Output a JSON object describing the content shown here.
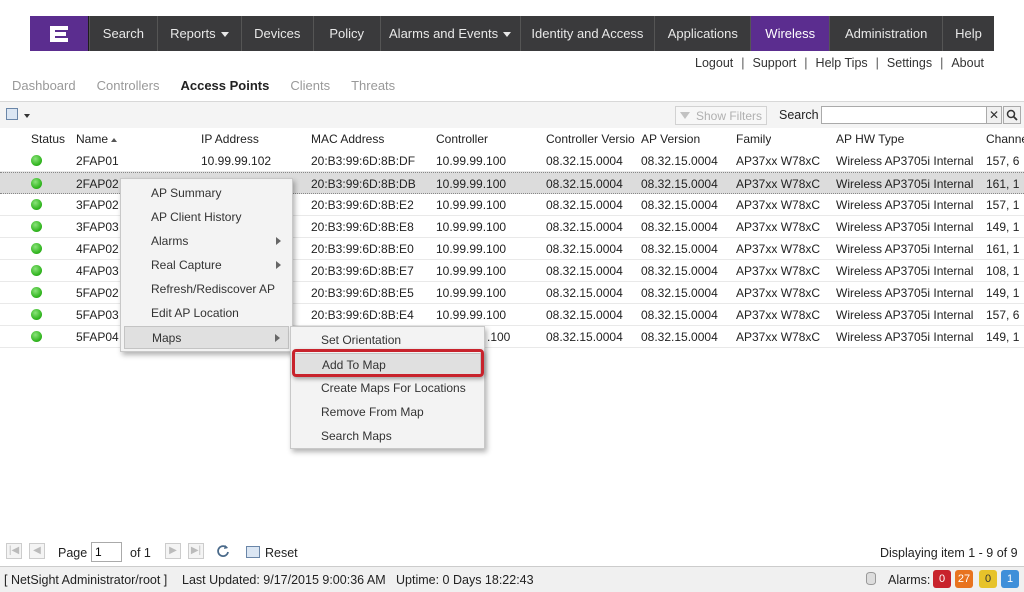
{
  "nav": {
    "logo_icon": "extreme-networks-logo",
    "items": [
      {
        "label": "Search",
        "dropdown": false,
        "active": false
      },
      {
        "label": "Reports",
        "dropdown": true,
        "active": false
      },
      {
        "label": "Devices",
        "dropdown": false,
        "active": false
      },
      {
        "label": "Policy",
        "dropdown": false,
        "active": false
      },
      {
        "label": "Alarms and Events",
        "dropdown": true,
        "active": false
      },
      {
        "label": "Identity and Access",
        "dropdown": false,
        "active": false
      },
      {
        "label": "Applications",
        "dropdown": false,
        "active": false
      },
      {
        "label": "Wireless",
        "dropdown": false,
        "active": true
      },
      {
        "label": "Administration",
        "dropdown": false,
        "active": false
      },
      {
        "label": "Help",
        "dropdown": false,
        "active": false
      }
    ],
    "active_color": "#5b2d8f",
    "bar_color": "#3a3a3c"
  },
  "top_links": [
    "Logout",
    "Support",
    "Help Tips",
    "Settings",
    "About"
  ],
  "subtabs": [
    {
      "label": "Dashboard",
      "active": false
    },
    {
      "label": "Controllers",
      "active": false
    },
    {
      "label": "Access Points",
      "active": true
    },
    {
      "label": "Clients",
      "active": false
    },
    {
      "label": "Threats",
      "active": false
    }
  ],
  "toolbar": {
    "show_filters": "Show Filters",
    "search_label": "Search",
    "search_value": "",
    "clear_icon": "close-icon",
    "search_icon": "magnifier-icon"
  },
  "table": {
    "columns": [
      "Status",
      "Name",
      "IP Address",
      "MAC Address",
      "Controller",
      "Controller Versio",
      "AP Version",
      "Family",
      "AP HW Type",
      "Channe"
    ],
    "sorted_column": "Name",
    "rows": [
      {
        "status": "up",
        "name": "2FAP01",
        "ip": "10.99.99.102",
        "mac": "20:B3:99:6D:8B:DF",
        "controller": "10.99.99.100",
        "ctrl_version": "08.32.15.0004",
        "ap_version": "08.32.15.0004",
        "family": "AP37xx W78xC",
        "hw": "Wireless AP3705i Internal",
        "channel": "157, 6"
      },
      {
        "status": "up",
        "name": "2FAP02",
        "ip": "",
        "mac": "20:B3:99:6D:8B:DB",
        "controller": "10.99.99.100",
        "ctrl_version": "08.32.15.0004",
        "ap_version": "08.32.15.0004",
        "family": "AP37xx W78xC",
        "hw": "Wireless AP3705i Internal",
        "channel": "161, 1"
      },
      {
        "status": "up",
        "name": "3FAP02",
        "ip": "",
        "mac": "20:B3:99:6D:8B:E2",
        "controller": "10.99.99.100",
        "ctrl_version": "08.32.15.0004",
        "ap_version": "08.32.15.0004",
        "family": "AP37xx W78xC",
        "hw": "Wireless AP3705i Internal",
        "channel": "157, 1"
      },
      {
        "status": "up",
        "name": "3FAP03",
        "ip": "",
        "mac": "20:B3:99:6D:8B:E8",
        "controller": "10.99.99.100",
        "ctrl_version": "08.32.15.0004",
        "ap_version": "08.32.15.0004",
        "family": "AP37xx W78xC",
        "hw": "Wireless AP3705i Internal",
        "channel": "149, 1"
      },
      {
        "status": "up",
        "name": "4FAP02",
        "ip": "",
        "mac": "20:B3:99:6D:8B:E0",
        "controller": "10.99.99.100",
        "ctrl_version": "08.32.15.0004",
        "ap_version": "08.32.15.0004",
        "family": "AP37xx W78xC",
        "hw": "Wireless AP3705i Internal",
        "channel": "161, 1"
      },
      {
        "status": "up",
        "name": "4FAP03",
        "ip": "",
        "mac": "20:B3:99:6D:8B:E7",
        "controller": "10.99.99.100",
        "ctrl_version": "08.32.15.0004",
        "ap_version": "08.32.15.0004",
        "family": "AP37xx W78xC",
        "hw": "Wireless AP3705i Internal",
        "channel": "108, 1"
      },
      {
        "status": "up",
        "name": "5FAP02",
        "ip": "",
        "mac": "20:B3:99:6D:8B:E5",
        "controller": "10.99.99.100",
        "ctrl_version": "08.32.15.0004",
        "ap_version": "08.32.15.0004",
        "family": "AP37xx W78xC",
        "hw": "Wireless AP3705i Internal",
        "channel": "149, 1"
      },
      {
        "status": "up",
        "name": "5FAP03",
        "ip": "",
        "mac": "20:B3:99:6D:8B:E4",
        "controller": "10.99.99.100",
        "ctrl_version": "08.32.15.0004",
        "ap_version": "08.32.15.0004",
        "family": "AP37xx W78xC",
        "hw": "Wireless AP3705i Internal",
        "channel": "157, 6"
      },
      {
        "status": "up",
        "name": "5FAP04",
        "ip": "",
        "mac": "",
        "controller": ".100",
        "ctrl_version": "08.32.15.0004",
        "ap_version": "08.32.15.0004",
        "family": "AP37xx W78xC",
        "hw": "Wireless AP3705i Internal",
        "channel": "149, 1"
      }
    ],
    "status_color": "#31b51f"
  },
  "context_menu": {
    "items": [
      {
        "label": "AP Summary",
        "submenu": false
      },
      {
        "label": "AP Client History",
        "submenu": false
      },
      {
        "label": "Alarms",
        "submenu": true
      },
      {
        "label": "Real Capture",
        "submenu": true
      },
      {
        "label": "Refresh/Rediscover AP",
        "submenu": false
      },
      {
        "label": "Edit AP Location",
        "submenu": false
      },
      {
        "label": "Maps",
        "submenu": true,
        "highlighted": true
      }
    ]
  },
  "maps_submenu": {
    "items": [
      {
        "label": "Set Orientation"
      },
      {
        "label": "Add To Map",
        "highlighted": true
      },
      {
        "label": "Create Maps For Locations"
      },
      {
        "label": "Remove From Map"
      },
      {
        "label": "Search Maps"
      }
    ],
    "annotation_color": "#c8232c"
  },
  "pager": {
    "page_label": "Page",
    "page_value": "1",
    "of_label": "of 1",
    "reset_label": "Reset",
    "displaying": "Displaying item 1 - 9 of 9"
  },
  "status_bar": {
    "user": "[ NetSight Administrator/root ]",
    "last_updated": "Last Updated: 9/17/2015 9:00:36 AM",
    "uptime": "Uptime: 0 Days 18:22:43",
    "alarms_label": "Alarms:",
    "alarm_counts": [
      {
        "value": "0",
        "color": "#c8232c"
      },
      {
        "value": "27",
        "color": "#e8731f"
      },
      {
        "value": "0",
        "color": "#e7c32a"
      },
      {
        "value": "1",
        "color": "#3f8fd9"
      }
    ]
  }
}
